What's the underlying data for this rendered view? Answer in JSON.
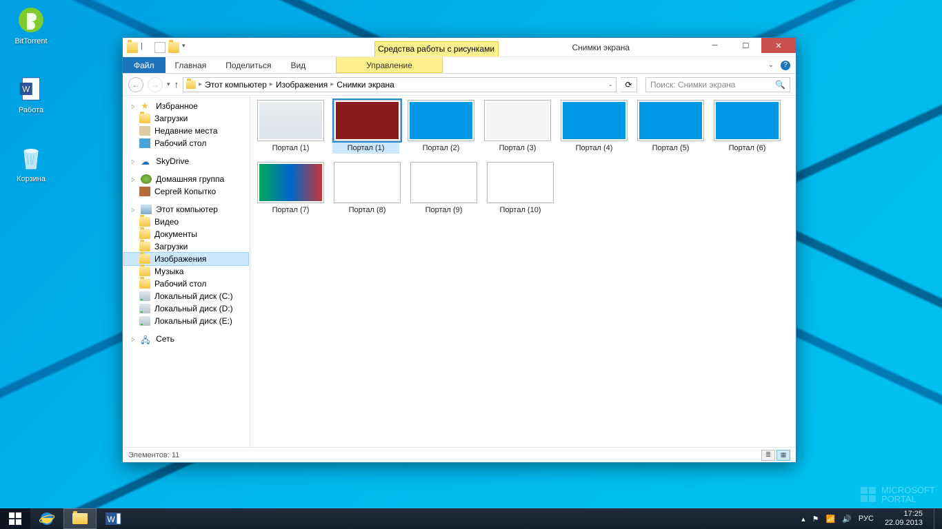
{
  "desktop_icons": [
    {
      "name": "bittorrent-icon",
      "label": "BitTorrent"
    },
    {
      "name": "word-doc-icon",
      "label": "Работа"
    },
    {
      "name": "recycle-bin-icon",
      "label": "Корзина"
    }
  ],
  "window": {
    "context_tab": "Средства работы с рисунками",
    "title": "Снимки экрана",
    "ribbon": {
      "file": "Файл",
      "tabs": [
        "Главная",
        "Поделиться",
        "Вид"
      ],
      "context": "Управление"
    },
    "breadcrumbs": [
      "Этот компьютер",
      "Изображения",
      "Снимки экрана"
    ],
    "search_placeholder": "Поиск: Снимки экрана",
    "sidebar": {
      "favorites": {
        "head": "Избранное",
        "items": [
          "Загрузки",
          "Недавние места",
          "Рабочий стол"
        ]
      },
      "skydrive": "SkyDrive",
      "homegroup": {
        "head": "Домашняя группа",
        "user": "Сергей Копытко"
      },
      "this_pc": {
        "head": "Этот компьютер",
        "items": [
          "Видео",
          "Документы",
          "Загрузки",
          "Изображения",
          "Музыка",
          "Рабочий стол",
          "Локальный диск (C:)",
          "Локальный диск (D:)",
          "Локальный диск (E:)"
        ],
        "selected_index": 3
      },
      "network": "Сеть"
    },
    "files": [
      {
        "label": "Портал (1)"
      },
      {
        "label": "Портал (1)",
        "selected": true
      },
      {
        "label": "Портал (2)"
      },
      {
        "label": "Портал (3)"
      },
      {
        "label": "Портал (4)"
      },
      {
        "label": "Портал (5)"
      },
      {
        "label": "Портал (6)"
      },
      {
        "label": "Портал (7)"
      },
      {
        "label": "Портал (8)"
      },
      {
        "label": "Портал (9)"
      },
      {
        "label": "Портал (10)"
      }
    ],
    "status": "Элементов: 11"
  },
  "taskbar": {
    "lang": "РУС",
    "time": "17:25",
    "date": "22.09.2013"
  },
  "watermark": {
    "line1": "MICROSOFT",
    "line2": "PORTAL"
  }
}
